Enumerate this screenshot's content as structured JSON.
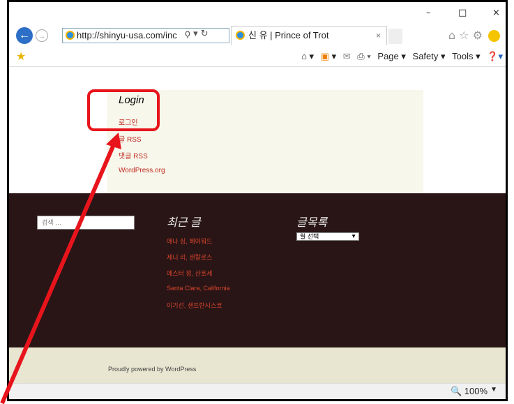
{
  "window": {
    "minimize": "–",
    "maximize": "□",
    "close": "×"
  },
  "address_bar": {
    "url": "http://shinyu-usa.com/inc",
    "tools": "ϙ ▾ ↻"
  },
  "tab": {
    "title": "신 유 | Prince of Trot",
    "close": "×"
  },
  "command_bar": {
    "page": "Page ▾",
    "safety": "Safety ▾",
    "tools": "Tools ▾",
    "help": "❓▾"
  },
  "widget": {
    "title": "Login",
    "links": [
      "로그인",
      "글 RSS",
      "댓글 RSS",
      "WordPress.org"
    ]
  },
  "footer": {
    "search_placeholder": "검색 …",
    "recent_posts_title": "최근 글",
    "recent_posts": [
      "애나 심, 헤이워드",
      "제니 리, 샌칼로스",
      "에스터 정, 산호세",
      "Santa Clara, California",
      "이기선, 샌프란시스코"
    ],
    "archives_title": "글목록",
    "archives_select": "월 선택"
  },
  "credits": "Proudly powered by WordPress",
  "status_bar": {
    "zoom": "100%"
  },
  "colors": {
    "annotation": "#e8141c",
    "footer_bg": "#2a1516",
    "link": "#c0281c"
  }
}
